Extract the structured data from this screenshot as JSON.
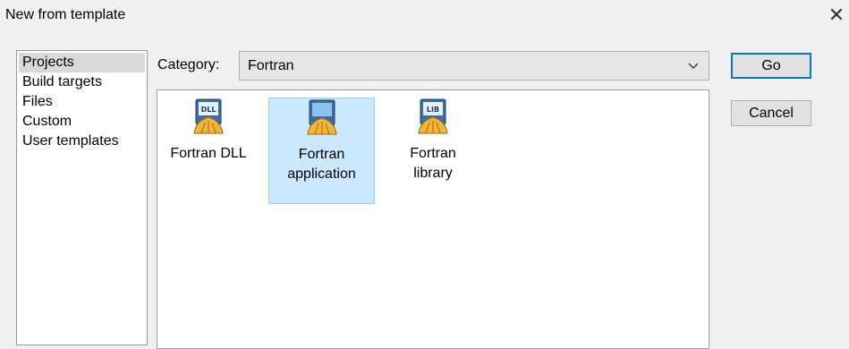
{
  "window": {
    "title": "New from template",
    "close_glyph": "✕"
  },
  "sidebar": {
    "items": [
      {
        "label": "Projects",
        "selected": true
      },
      {
        "label": "Build targets",
        "selected": false
      },
      {
        "label": "Files",
        "selected": false
      },
      {
        "label": "Custom",
        "selected": false
      },
      {
        "label": "User templates",
        "selected": false
      }
    ]
  },
  "category": {
    "label": "Category:",
    "value": "Fortran"
  },
  "templates": [
    {
      "label": "Fortran DLL",
      "icon": "fortran-dll-icon",
      "badge": "DLL",
      "selected": false
    },
    {
      "label": "Fortran application",
      "icon": "fortran-application-icon",
      "badge": "",
      "selected": true
    },
    {
      "label": "Fortran library",
      "icon": "fortran-library-icon",
      "badge": "LIB",
      "selected": false
    }
  ],
  "buttons": {
    "go": "Go",
    "cancel": "Cancel"
  },
  "colors": {
    "selection": "#cce8ff",
    "selection_border": "#99d1ff",
    "default_button_border": "#0078d7"
  }
}
